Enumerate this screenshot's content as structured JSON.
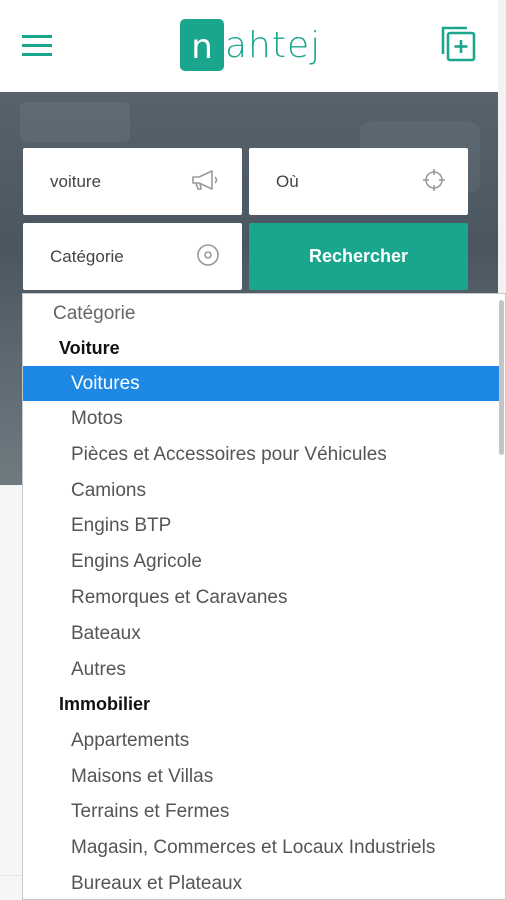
{
  "header": {
    "logo_text": "ahtej",
    "logo_letter": "n",
    "menu_icon": "hamburger-menu-icon",
    "add_icon": "add-listing-icon",
    "brand_color": "#1aa58d"
  },
  "search": {
    "keyword_value": "voiture",
    "keyword_icon": "megaphone-icon",
    "location_value": "Où",
    "location_icon": "crosshair-icon",
    "category_value": "Catégorie",
    "category_icon": "target-icon",
    "submit_label": "Rechercher"
  },
  "dropdown": {
    "selected_color": "#1e88e5",
    "placeholder": "Catégorie",
    "groups": [
      {
        "label": "Voiture",
        "options": [
          "Voitures",
          "Motos",
          "Pièces et Accessoires pour Véhicules",
          "Camions",
          "Engins BTP",
          "Engins Agricole",
          "Remorques et Caravanes",
          "Bateaux",
          "Autres"
        ]
      },
      {
        "label": "Immobilier",
        "options": [
          "Appartements",
          "Maisons et Villas",
          "Terrains et Fermes",
          "Magasin, Commerces et Locaux Industriels",
          "Bureaux et Plateaux"
        ]
      }
    ],
    "selected_option": "Voitures"
  }
}
